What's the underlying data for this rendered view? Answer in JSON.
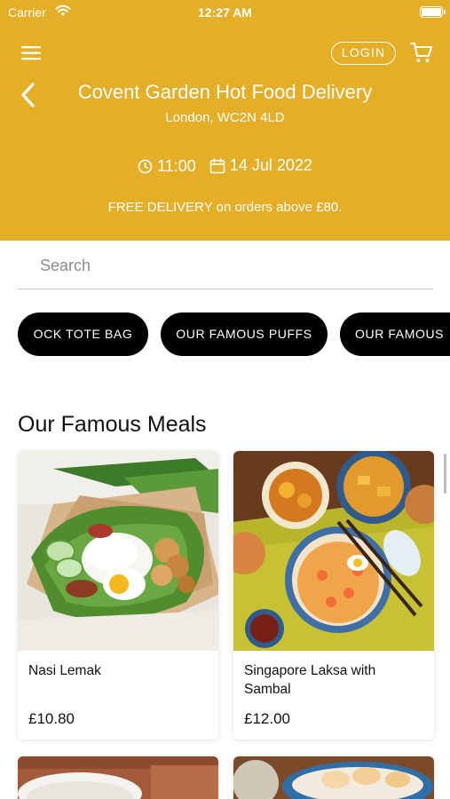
{
  "status_bar": {
    "carrier": "Carrier",
    "time": "12:27 AM"
  },
  "header": {
    "login_label": "LOGIN",
    "store_title": "Covent Garden Hot Food Delivery",
    "store_address": "London, WC2N 4LD",
    "time": "11:00",
    "date": "14 Jul 2022",
    "free_delivery": "FREE DELIVERY on orders above £80.",
    "background_color": "#E5AE27"
  },
  "search": {
    "placeholder": "Search",
    "value": ""
  },
  "categories": [
    "OCK TOTE BAG",
    "OUR FAMOUS PUFFS",
    "OUR FAMOUS"
  ],
  "section": {
    "title": "Our Famous Meals"
  },
  "products": [
    {
      "name": "Nasi Lemak",
      "price": "£10.80"
    },
    {
      "name": "Singapore Laksa with Sambal",
      "price": "£12.00"
    }
  ],
  "icons": [
    "wifi-icon",
    "battery-icon",
    "hamburger-menu-icon",
    "cart-icon",
    "back-chevron-icon",
    "clock-icon",
    "calendar-icon"
  ]
}
